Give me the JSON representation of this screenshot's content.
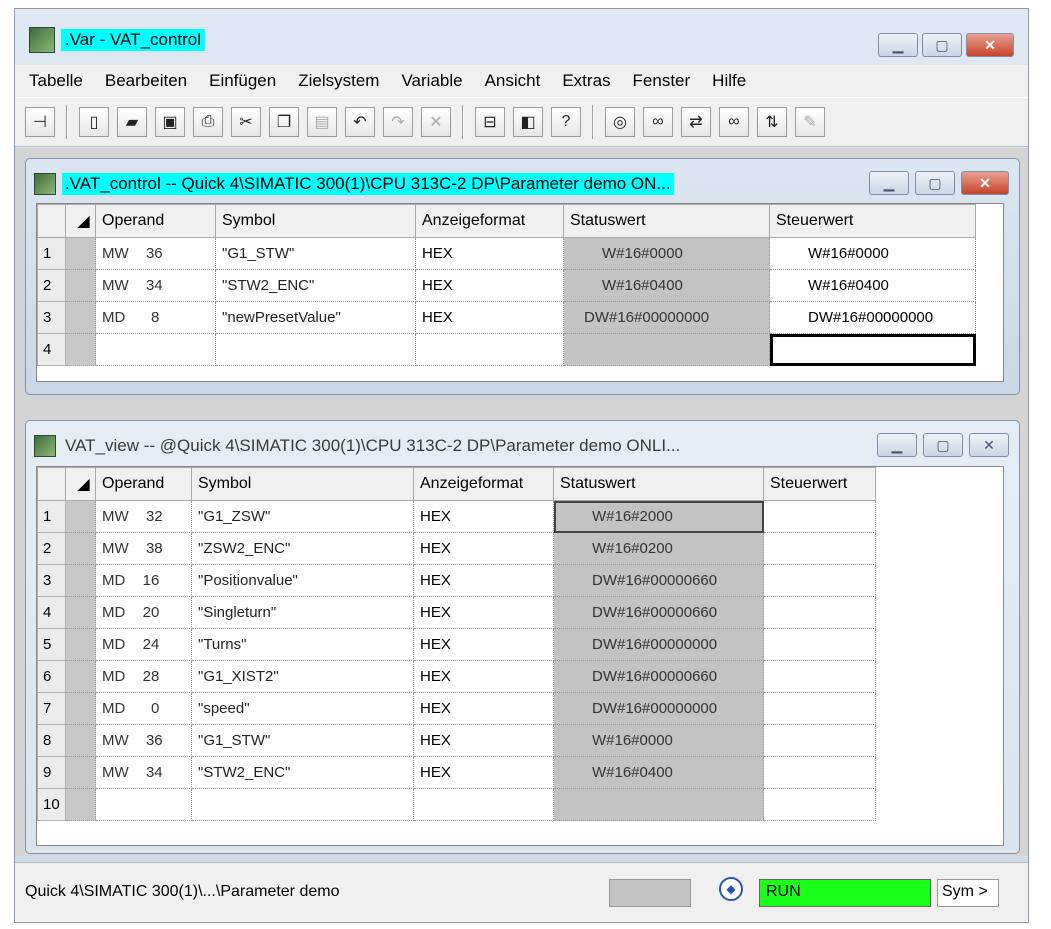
{
  "window": {
    "title": ".Var - VAT_control"
  },
  "menu": [
    "Tabelle",
    "Bearbeiten",
    "Einfügen",
    "Zielsystem",
    "Variable",
    "Ansicht",
    "Extras",
    "Fenster",
    "Hilfe"
  ],
  "vat_control": {
    "title": ".VAT_control -- Quick 4\\SIMATIC 300(1)\\CPU 313C-2 DP\\Parameter demo  ON...",
    "headers": {
      "operand": "Operand",
      "symbol": "Symbol",
      "format": "Anzeigeformat",
      "status": "Statuswert",
      "control": "Steuerwert"
    },
    "rows": [
      {
        "n": "1",
        "type": "MW",
        "addr": "36",
        "symbol": "\"G1_STW\"",
        "format": "HEX",
        "status": "W#16#0000",
        "control": "W#16#0000"
      },
      {
        "n": "2",
        "type": "MW",
        "addr": "34",
        "symbol": "\"STW2_ENC\"",
        "format": "HEX",
        "status": "W#16#0400",
        "control": "W#16#0400"
      },
      {
        "n": "3",
        "type": "MD",
        "addr": "8",
        "symbol": "\"newPresetValue\"",
        "format": "HEX",
        "status": "DW#16#00000000",
        "control": "DW#16#00000000"
      },
      {
        "n": "4",
        "type": "",
        "addr": "",
        "symbol": "",
        "format": "",
        "status": "",
        "control": ""
      }
    ]
  },
  "vat_view": {
    "title": "VAT_view -- @Quick 4\\SIMATIC 300(1)\\CPU 313C-2 DP\\Parameter demo  ONLI...",
    "headers": {
      "operand": "Operand",
      "symbol": "Symbol",
      "format": "Anzeigeformat",
      "status": "Statuswert",
      "control": "Steuerwert"
    },
    "rows": [
      {
        "n": "1",
        "type": "MW",
        "addr": "32",
        "symbol": "\"G1_ZSW\"",
        "format": "HEX",
        "status": "W#16#2000",
        "control": ""
      },
      {
        "n": "2",
        "type": "MW",
        "addr": "38",
        "symbol": "\"ZSW2_ENC\"",
        "format": "HEX",
        "status": "W#16#0200",
        "control": ""
      },
      {
        "n": "3",
        "type": "MD",
        "addr": "16",
        "symbol": "\"Positionvalue\"",
        "format": "HEX",
        "status": "DW#16#00000660",
        "control": ""
      },
      {
        "n": "4",
        "type": "MD",
        "addr": "20",
        "symbol": "\"Singleturn\"",
        "format": "HEX",
        "status": "DW#16#00000660",
        "control": ""
      },
      {
        "n": "5",
        "type": "MD",
        "addr": "24",
        "symbol": "\"Turns\"",
        "format": "HEX",
        "status": "DW#16#00000000",
        "control": ""
      },
      {
        "n": "6",
        "type": "MD",
        "addr": "28",
        "symbol": "\"G1_XIST2\"",
        "format": "HEX",
        "status": "DW#16#00000660",
        "control": ""
      },
      {
        "n": "7",
        "type": "MD",
        "addr": "0",
        "symbol": "\"speed\"",
        "format": "HEX",
        "status": "DW#16#00000000",
        "control": ""
      },
      {
        "n": "8",
        "type": "MW",
        "addr": "36",
        "symbol": "\"G1_STW\"",
        "format": "HEX",
        "status": "W#16#0000",
        "control": ""
      },
      {
        "n": "9",
        "type": "MW",
        "addr": "34",
        "symbol": "\"STW2_ENC\"",
        "format": "HEX",
        "status": "W#16#0400",
        "control": ""
      },
      {
        "n": "10",
        "type": "",
        "addr": "",
        "symbol": "",
        "format": "",
        "status": "",
        "control": ""
      }
    ]
  },
  "status": {
    "path": "Quick 4\\SIMATIC 300(1)\\...\\Parameter demo",
    "mode": "RUN",
    "sym": "Sym >"
  },
  "colors": {
    "active_title": "#00ffff",
    "run": "#1aff1a",
    "status_cell": "#c3c3c3"
  }
}
